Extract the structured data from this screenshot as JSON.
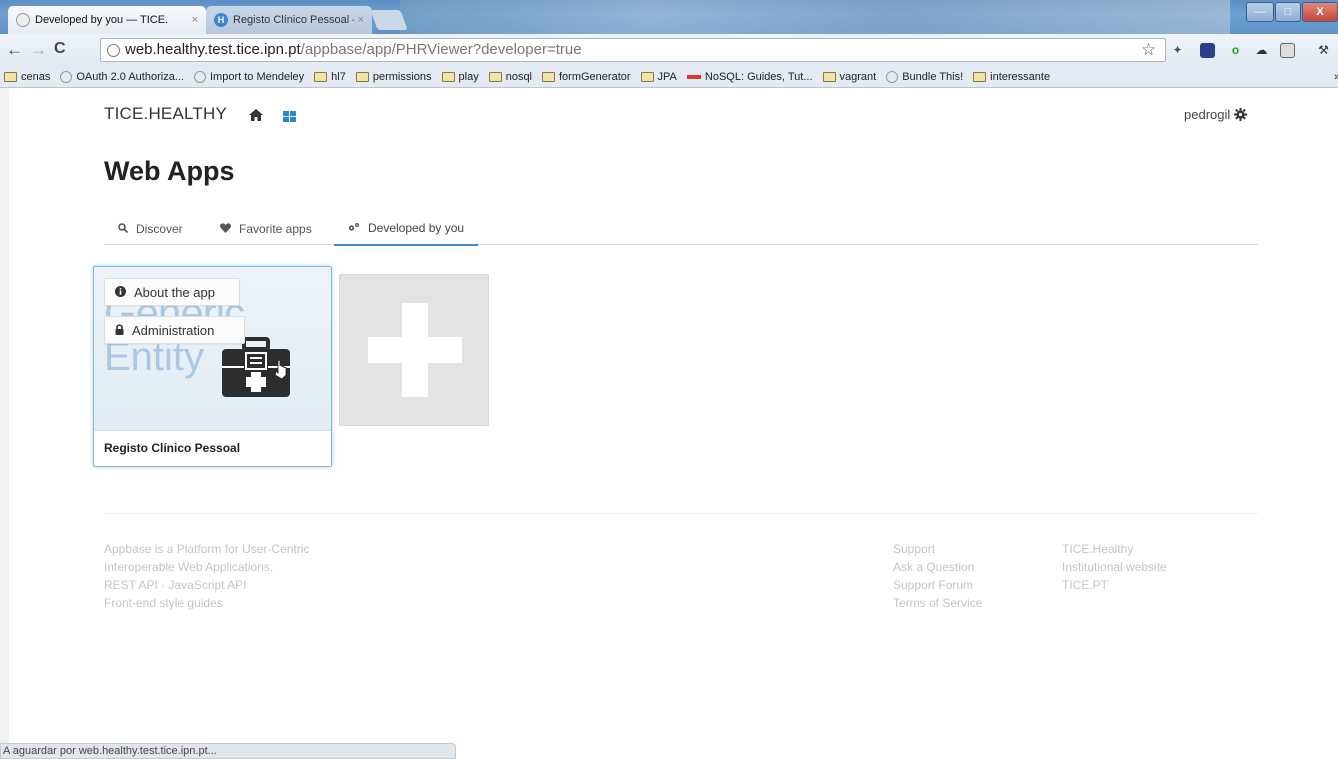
{
  "browser": {
    "tabs": [
      {
        "title": "Developed by you — TICE.",
        "close": "×"
      },
      {
        "title": "Registo Clínico Pessoal —",
        "close": "×",
        "favicon_letter": "H"
      }
    ],
    "window_controls": {
      "minimize": "—",
      "maximize": "□",
      "close": "X"
    },
    "nav": {
      "back": "←",
      "forward": "→",
      "reload": "C"
    },
    "url": {
      "host": "web.healthy.test.tice.ipn.pt",
      "path": "/appbase/app/PHRViewer?developer=true"
    },
    "bookmark_star": "☆",
    "bookmarks": [
      {
        "label": "cenas",
        "icon": "folder-icon"
      },
      {
        "label": "OAuth 2.0 Authoriza...",
        "icon": "page-icon"
      },
      {
        "label": "Import to Mendeley",
        "icon": "page-icon"
      },
      {
        "label": "hl7",
        "icon": "folder-icon"
      },
      {
        "label": "permissions",
        "icon": "folder-icon"
      },
      {
        "label": "play",
        "icon": "folder-icon"
      },
      {
        "label": "nosql",
        "icon": "folder-icon"
      },
      {
        "label": "formGenerator",
        "icon": "folder-icon"
      },
      {
        "label": "JPA",
        "icon": "folder-icon"
      },
      {
        "label": "NoSQL: Guides, Tut...",
        "icon": "nosql-icon"
      },
      {
        "label": "vagrant",
        "icon": "folder-icon"
      },
      {
        "label": "Bundle This!",
        "icon": "page-icon"
      },
      {
        "label": "interessante",
        "icon": "folder-icon"
      }
    ],
    "overflow_chevron": "»",
    "status": "A aguardar por web.healthy.test.tice.ipn.pt..."
  },
  "header": {
    "brand": "TICE.HEALTHY",
    "user": "pedrogil"
  },
  "main": {
    "title": "Web Apps",
    "tabs": [
      {
        "label": "Discover",
        "icon": "search-icon"
      },
      {
        "label": "Favorite apps",
        "icon": "heart-icon"
      },
      {
        "label": "Developed by you",
        "icon": "cogs-icon",
        "active": true
      }
    ],
    "app_card": {
      "thumb_line1": "Generic",
      "thumb_line2": "Entity",
      "about": "About the app",
      "admin": "Administration",
      "name": "Registo Clínico Pessoal"
    }
  },
  "footer": {
    "col1": [
      "Appbase is a Platform for User-Centric",
      "Interoperable Web Applications.",
      "REST API  ·  JavaScript API",
      "Front-end style guides"
    ],
    "col2": [
      "Support",
      "Ask a Question",
      "Support Forum",
      "Terms of Service"
    ],
    "col3": [
      "TICE.Healthy",
      "Institutional website",
      "TICE.PT"
    ]
  },
  "colors": {
    "accent": "#3a8fd0",
    "card_border": "#7db8e0",
    "footer_text": "#c4c4c4"
  }
}
